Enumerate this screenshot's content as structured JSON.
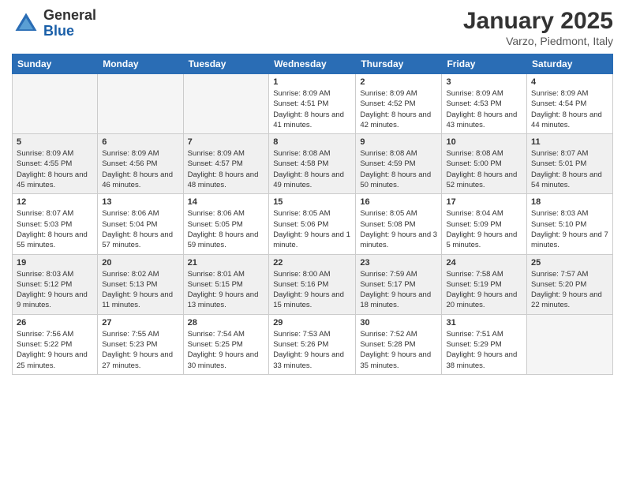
{
  "header": {
    "logo_general": "General",
    "logo_blue": "Blue",
    "month_year": "January 2025",
    "location": "Varzo, Piedmont, Italy"
  },
  "weekdays": [
    "Sunday",
    "Monday",
    "Tuesday",
    "Wednesday",
    "Thursday",
    "Friday",
    "Saturday"
  ],
  "weeks": [
    [
      {
        "day": "",
        "info": ""
      },
      {
        "day": "",
        "info": ""
      },
      {
        "day": "",
        "info": ""
      },
      {
        "day": "1",
        "info": "Sunrise: 8:09 AM\nSunset: 4:51 PM\nDaylight: 8 hours and 41 minutes."
      },
      {
        "day": "2",
        "info": "Sunrise: 8:09 AM\nSunset: 4:52 PM\nDaylight: 8 hours and 42 minutes."
      },
      {
        "day": "3",
        "info": "Sunrise: 8:09 AM\nSunset: 4:53 PM\nDaylight: 8 hours and 43 minutes."
      },
      {
        "day": "4",
        "info": "Sunrise: 8:09 AM\nSunset: 4:54 PM\nDaylight: 8 hours and 44 minutes."
      }
    ],
    [
      {
        "day": "5",
        "info": "Sunrise: 8:09 AM\nSunset: 4:55 PM\nDaylight: 8 hours and 45 minutes."
      },
      {
        "day": "6",
        "info": "Sunrise: 8:09 AM\nSunset: 4:56 PM\nDaylight: 8 hours and 46 minutes."
      },
      {
        "day": "7",
        "info": "Sunrise: 8:09 AM\nSunset: 4:57 PM\nDaylight: 8 hours and 48 minutes."
      },
      {
        "day": "8",
        "info": "Sunrise: 8:08 AM\nSunset: 4:58 PM\nDaylight: 8 hours and 49 minutes."
      },
      {
        "day": "9",
        "info": "Sunrise: 8:08 AM\nSunset: 4:59 PM\nDaylight: 8 hours and 50 minutes."
      },
      {
        "day": "10",
        "info": "Sunrise: 8:08 AM\nSunset: 5:00 PM\nDaylight: 8 hours and 52 minutes."
      },
      {
        "day": "11",
        "info": "Sunrise: 8:07 AM\nSunset: 5:01 PM\nDaylight: 8 hours and 54 minutes."
      }
    ],
    [
      {
        "day": "12",
        "info": "Sunrise: 8:07 AM\nSunset: 5:03 PM\nDaylight: 8 hours and 55 minutes."
      },
      {
        "day": "13",
        "info": "Sunrise: 8:06 AM\nSunset: 5:04 PM\nDaylight: 8 hours and 57 minutes."
      },
      {
        "day": "14",
        "info": "Sunrise: 8:06 AM\nSunset: 5:05 PM\nDaylight: 8 hours and 59 minutes."
      },
      {
        "day": "15",
        "info": "Sunrise: 8:05 AM\nSunset: 5:06 PM\nDaylight: 9 hours and 1 minute."
      },
      {
        "day": "16",
        "info": "Sunrise: 8:05 AM\nSunset: 5:08 PM\nDaylight: 9 hours and 3 minutes."
      },
      {
        "day": "17",
        "info": "Sunrise: 8:04 AM\nSunset: 5:09 PM\nDaylight: 9 hours and 5 minutes."
      },
      {
        "day": "18",
        "info": "Sunrise: 8:03 AM\nSunset: 5:10 PM\nDaylight: 9 hours and 7 minutes."
      }
    ],
    [
      {
        "day": "19",
        "info": "Sunrise: 8:03 AM\nSunset: 5:12 PM\nDaylight: 9 hours and 9 minutes."
      },
      {
        "day": "20",
        "info": "Sunrise: 8:02 AM\nSunset: 5:13 PM\nDaylight: 9 hours and 11 minutes."
      },
      {
        "day": "21",
        "info": "Sunrise: 8:01 AM\nSunset: 5:15 PM\nDaylight: 9 hours and 13 minutes."
      },
      {
        "day": "22",
        "info": "Sunrise: 8:00 AM\nSunset: 5:16 PM\nDaylight: 9 hours and 15 minutes."
      },
      {
        "day": "23",
        "info": "Sunrise: 7:59 AM\nSunset: 5:17 PM\nDaylight: 9 hours and 18 minutes."
      },
      {
        "day": "24",
        "info": "Sunrise: 7:58 AM\nSunset: 5:19 PM\nDaylight: 9 hours and 20 minutes."
      },
      {
        "day": "25",
        "info": "Sunrise: 7:57 AM\nSunset: 5:20 PM\nDaylight: 9 hours and 22 minutes."
      }
    ],
    [
      {
        "day": "26",
        "info": "Sunrise: 7:56 AM\nSunset: 5:22 PM\nDaylight: 9 hours and 25 minutes."
      },
      {
        "day": "27",
        "info": "Sunrise: 7:55 AM\nSunset: 5:23 PM\nDaylight: 9 hours and 27 minutes."
      },
      {
        "day": "28",
        "info": "Sunrise: 7:54 AM\nSunset: 5:25 PM\nDaylight: 9 hours and 30 minutes."
      },
      {
        "day": "29",
        "info": "Sunrise: 7:53 AM\nSunset: 5:26 PM\nDaylight: 9 hours and 33 minutes."
      },
      {
        "day": "30",
        "info": "Sunrise: 7:52 AM\nSunset: 5:28 PM\nDaylight: 9 hours and 35 minutes."
      },
      {
        "day": "31",
        "info": "Sunrise: 7:51 AM\nSunset: 5:29 PM\nDaylight: 9 hours and 38 minutes."
      },
      {
        "day": "",
        "info": ""
      }
    ]
  ]
}
